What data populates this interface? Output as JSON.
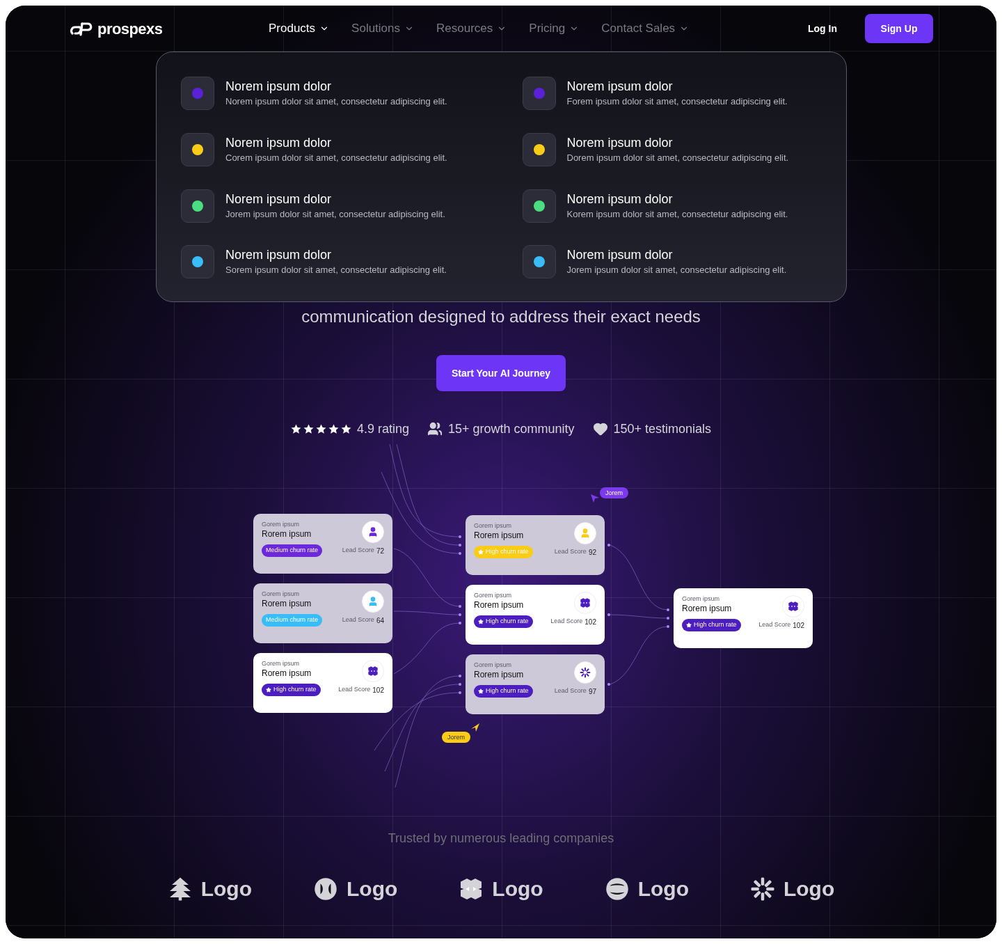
{
  "header": {
    "logo": "prospexs",
    "nav": [
      {
        "label": "Products",
        "selected": true
      },
      {
        "label": "Solutions",
        "selected": false
      },
      {
        "label": "Resources",
        "selected": false
      },
      {
        "label": "Pricing",
        "selected": false
      },
      {
        "label": "Contact Sales",
        "selected": false
      }
    ],
    "login": "Log In",
    "signup": "Sign Up"
  },
  "menu": {
    "items": [
      {
        "title": "Norem ipsum dolor",
        "text": "Norem ipsum dolor sit amet, consectetur adipiscing elit.",
        "color": "#5b21d6"
      },
      {
        "title": "Norem ipsum dolor",
        "text": "Forem ipsum dolor sit amet, consectetur adipiscing elit.",
        "color": "#5b21d6"
      },
      {
        "title": "Norem ipsum dolor",
        "text": "Corem ipsum dolor sit amet, consectetur adipiscing elit.",
        "color": "#facc15"
      },
      {
        "title": "Norem ipsum dolor",
        "text": "Dorem ipsum dolor sit amet, consectetur adipiscing elit.",
        "color": "#facc15"
      },
      {
        "title": "Norem ipsum dolor",
        "text": "Jorem ipsum dolor sit amet, consectetur adipiscing elit.",
        "color": "#4ade80"
      },
      {
        "title": "Norem ipsum dolor",
        "text": "Korem ipsum dolor sit amet, consectetur adipiscing elit.",
        "color": "#4ade80"
      },
      {
        "title": "Norem ipsum dolor",
        "text": "Sorem ipsum dolor sit amet, consectetur adipiscing elit.",
        "color": "#38bdf8"
      },
      {
        "title": "Norem ipsum dolor",
        "text": "Jorem ipsum dolor sit amet, consectetur adipiscing elit.",
        "color": "#38bdf8"
      }
    ]
  },
  "hero": {
    "subtitle": "communication designed to address their exact needs",
    "cta": "Start Your AI Journey",
    "stats": [
      {
        "kind": "rating",
        "stars": 5,
        "label": "4.9 rating"
      },
      {
        "kind": "community",
        "label": "15+ growth community"
      },
      {
        "kind": "testimonials",
        "label": "150+ testimonials"
      }
    ]
  },
  "diagram": {
    "cards": [
      {
        "eyebrow": "Gorem ipsum",
        "title": "Rorem ipsum",
        "kind": "person",
        "highlighted": false,
        "badge": {
          "label": "Medium churn rate",
          "color": "#6d28d9",
          "star": false
        },
        "score_label": "Lead Score",
        "score": "72"
      },
      {
        "eyebrow": "Gorem ipsum",
        "title": "Rorem ipsum",
        "kind": "person",
        "highlighted": false,
        "badge": {
          "label": "Medium churn rate",
          "color": "#38bdf8",
          "star": false
        },
        "score_label": "Lead Score",
        "score": "64"
      },
      {
        "eyebrow": "Gorem ipsum",
        "title": "Rorem ipsum",
        "kind": "cubes",
        "highlighted": true,
        "badge": {
          "label": "High churn rate",
          "color": "#4c1dbf",
          "star": true
        },
        "score_label": "Lead Score",
        "score": "102"
      },
      {
        "eyebrow": "Gorem ipsum",
        "title": "Rorem ipsum",
        "kind": "person",
        "highlighted": false,
        "badge": {
          "label": "High churn rate",
          "color": "#facc15",
          "star": true
        },
        "score_label": "Lead Score",
        "score": "92"
      },
      {
        "eyebrow": "Gorem ipsum",
        "title": "Rorem ipsum",
        "kind": "cubes",
        "highlighted": true,
        "badge": {
          "label": "High churn rate",
          "color": "#4c1dbf",
          "star": true
        },
        "score_label": "Lead Score",
        "score": "102"
      },
      {
        "eyebrow": "Gorem ipsum",
        "title": "Rorem ipsum",
        "kind": "burst",
        "highlighted": false,
        "badge": {
          "label": "High churn rate",
          "color": "#4c1dbf",
          "star": true
        },
        "score_label": "Lead Score",
        "score": "97"
      },
      {
        "eyebrow": "Gorem ipsum",
        "title": "Rorem ipsum",
        "kind": "cubes",
        "highlighted": true,
        "badge": {
          "label": "High churn rate",
          "color": "#4c1dbf",
          "star": true
        },
        "score_label": "Lead Score",
        "score": "102"
      }
    ],
    "tags": [
      {
        "label": "Jorem",
        "color": "#7c3aed"
      },
      {
        "label": "Jorem",
        "color": "#facc15"
      }
    ]
  },
  "trusted": {
    "title": "Trusted by numerous leading companies",
    "logos": [
      {
        "kind": "tree",
        "label": "Logo"
      },
      {
        "kind": "split",
        "label": "Logo"
      },
      {
        "kind": "cubes",
        "label": "Logo"
      },
      {
        "kind": "ring",
        "label": "Logo"
      },
      {
        "kind": "burst",
        "label": "Logo"
      }
    ]
  }
}
